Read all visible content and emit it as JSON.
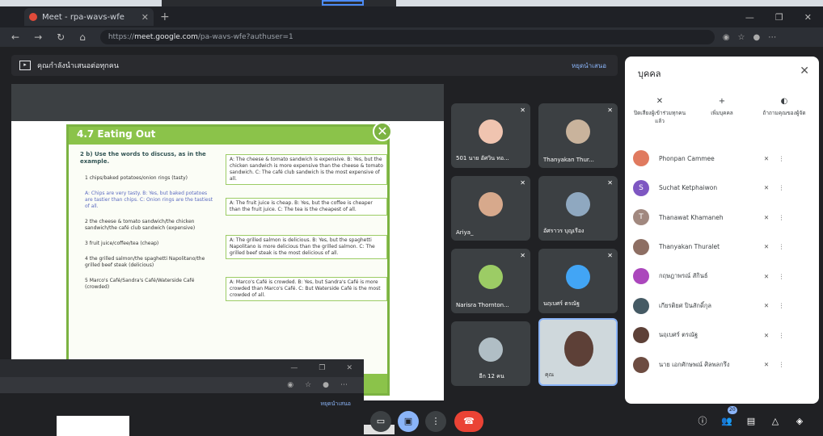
{
  "browser": {
    "tab_title": "Meet - rpa-wavs-wfe",
    "url_prefix": "https://",
    "url_host": "meet.google.com",
    "url_path": "/pa-wavs-wfe?authuser=1"
  },
  "presentation": {
    "banner": "คุณกำลังนำเสนอต่อทุกคน",
    "stop_label": "หยุดนำเสนอ"
  },
  "book": {
    "unit": "4.7  Eating Out",
    "instruction": "2  b) Use the words to discuss, as in the example.",
    "items": [
      "1  chips/baked potatoes/onion rings (tasty)",
      "A: Chips are very tasty. B: Yes, but baked potatoes are tastier than chips. C: Onion rings are the tastiest of all.",
      "2  the cheese & tomato sandwich/the chicken sandwich/the café club sandwich (expensive)",
      "3  fruit juice/coffee/tea (cheap)",
      "4  the grilled salmon/the spaghetti Napolitano/the grilled beef steak (delicious)",
      "5  Marco's Café/Sandra's Café/Waterside Café (crowded)"
    ],
    "dialogs": [
      "A: The cheese & tomato sandwich is expensive. B: Yes, but the chicken sandwich is more expensive than the cheese & tomato sandwich. C: The café club sandwich is the most expensive of all.",
      "A: The fruit juice is cheap. B: Yes, but the coffee is cheaper than the fruit juice. C: The tea is the cheapest of all.",
      "A: The grilled salmon is delicious. B: Yes, but the spaghetti Napolitano is more delicious than the grilled salmon. C: The grilled beef steak is the most delicious of all.",
      "A: Marco's Café is crowded. B: Yes, but Sandra's Café is more crowded than Marco's Café. C: But Waterside Café is the most crowded of all."
    ]
  },
  "tiles": [
    "501 นาย อัศวิน ทอ...",
    "Thanyakan Thur...",
    "Ariya_",
    "อัศราวร บุญเรือง",
    "Narisra Thornton...",
    "นฤเบศร์ ตรณัฐ",
    "อีก 12 คน",
    "คุณ"
  ],
  "panel": {
    "title": "บุคคล",
    "actions": [
      "ปิดเสียงผู้เข้าร่วมทุกคนแล้ว",
      "เพิ่มบุคคล",
      "ถ้าถามคุณของผู้จัด"
    ],
    "people": [
      {
        "name": "Phonpan Cammee",
        "color": "#e07a5f"
      },
      {
        "name": "Suchat Ketphaiwon",
        "color": "#7e57c2",
        "initial": "S"
      },
      {
        "name": "Thanawat Khamaneh",
        "color": "#a1887f",
        "initial": "T"
      },
      {
        "name": "Thanyakan Thuralet",
        "color": "#8d6e63"
      },
      {
        "name": "กฤษฎาพรณ์ สักินธ์",
        "color": "#ab47bc"
      },
      {
        "name": "เกียรติยศ ปินสักดิ์กุล",
        "color": "#455a64"
      },
      {
        "name": "นฤเบศร์ ตรณัฐ",
        "color": "#5d4037"
      },
      {
        "name": "นาย เอกศักษพณ์ ศิลพลกรึง",
        "color": "#6d4c41"
      }
    ],
    "participant_count": "20"
  },
  "overlay": {
    "stop_label": "หยุดนำเสนอ"
  }
}
